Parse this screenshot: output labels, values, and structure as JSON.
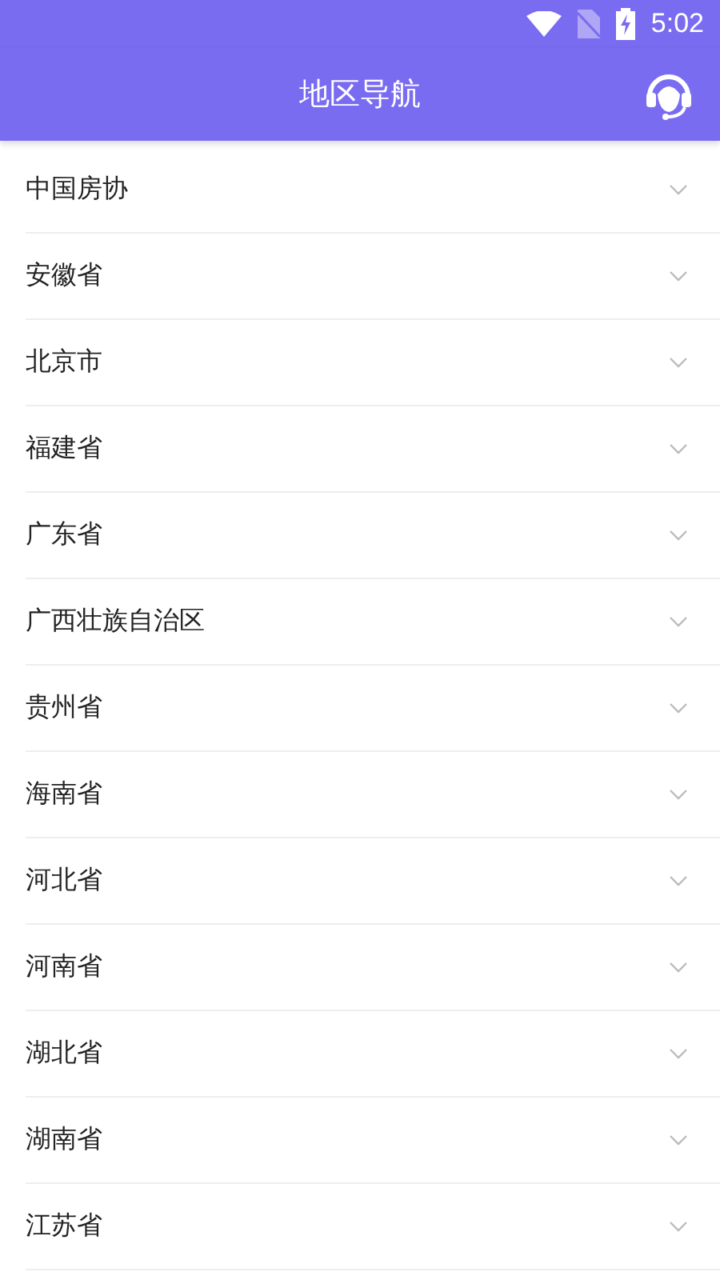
{
  "status_bar": {
    "time": "5:02"
  },
  "header": {
    "title": "地区导航"
  },
  "regions": [
    {
      "name": "中国房协",
      "expanded": false
    },
    {
      "name": "安徽省",
      "expanded": false
    },
    {
      "name": "北京市",
      "expanded": false
    },
    {
      "name": "福建省",
      "expanded": false
    },
    {
      "name": "广东省",
      "expanded": false
    },
    {
      "name": "广西壮族自治区",
      "expanded": false
    },
    {
      "name": "贵州省",
      "expanded": false
    },
    {
      "name": "海南省",
      "expanded": false
    },
    {
      "name": "河北省",
      "expanded": false
    },
    {
      "name": "河南省",
      "expanded": false
    },
    {
      "name": "湖北省",
      "expanded": false
    },
    {
      "name": "湖南省",
      "expanded": false
    },
    {
      "name": "江苏省",
      "expanded": false
    }
  ]
}
